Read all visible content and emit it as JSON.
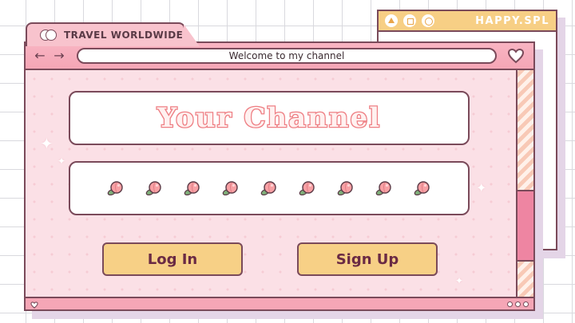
{
  "back_window": {
    "title": "HAPPY.SPL",
    "icons": [
      "triangle-icon",
      "square-icon",
      "circle-icon"
    ]
  },
  "main_window": {
    "tab_title": "TRAVEL WORLDWIDE",
    "address_text": "Welcome to my channel",
    "nav": {
      "back_label": "←",
      "forward_label": "→"
    },
    "heading": "Your Channel",
    "peach_count": 9,
    "buttons": {
      "login_label": "Log In",
      "signup_label": "Sign Up"
    }
  },
  "colors": {
    "accent_pink": "#f5a6b6",
    "window_bg": "#fbe0e6",
    "button_yellow": "#f7d086",
    "outline": "#7a4a5a",
    "scroll_thumb": "#ee85a2"
  }
}
